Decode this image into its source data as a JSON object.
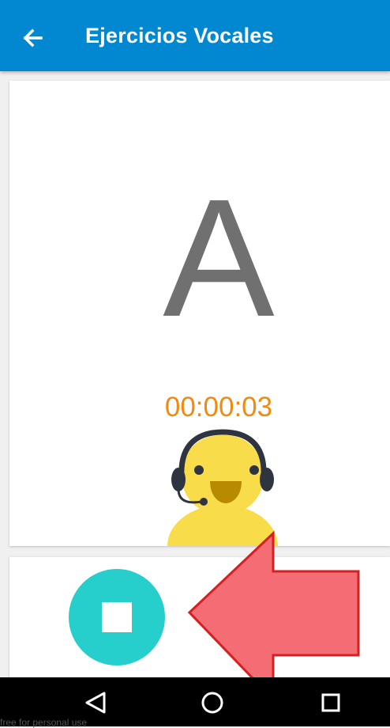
{
  "appbar": {
    "title": "Ejercicios Vocales",
    "back_icon": "arrow-back-icon",
    "color": "#0288d1"
  },
  "exercise": {
    "vowel": "A",
    "timer": "00:00:03",
    "timer_color": "#f08a13",
    "mascot_icon": "headset-mascot-icon"
  },
  "controls": {
    "stop_icon": "stop-icon",
    "stop_color": "#26cfcc",
    "pointer_icon": "red-arrow-left-icon"
  },
  "navbar": {
    "back_icon": "nav-back-icon",
    "home_icon": "nav-home-icon",
    "recents_icon": "nav-recents-icon"
  },
  "watermark": {
    "text": "free for personal use"
  }
}
